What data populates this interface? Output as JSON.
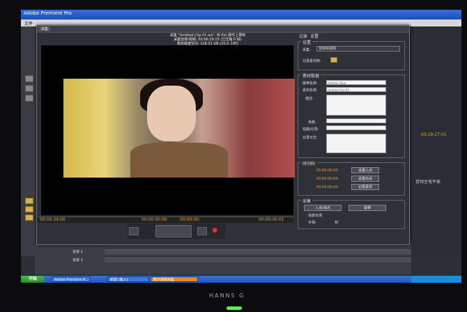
{
  "app": {
    "window_title": "Adobe Premiere Pro",
    "menu": [
      "文件"
    ]
  },
  "capture_dialog": {
    "tab_label": "采集",
    "info_line1": "采集 \"Untitled Clip 01.avi\", 到 Ext 硬件上录制",
    "info_line2": "采集音频/视频: 00:06:29:15 (已压缩 0 帧)",
    "info_line3": "剩余磁盘空间: 128.51 GB (10.0 小时)",
    "timecode_left": "00:06:34:00",
    "timecode_mid1": "00:00:00:00",
    "timecode_mid2": "00:00:00:",
    "timecode_right": "00:00:00:01"
  },
  "side_panel": {
    "tab_record": "记录",
    "tab_settings": "设置",
    "setup_group": "设置",
    "capture_label": "采集:",
    "capture_value": "音频和视频",
    "bin_label": "记录素材到:",
    "clip_data_group": "素材数据",
    "tape_name_label": "磁带名称:",
    "tape_name_value": "Untitled Tape",
    "clip_name_label": "素材名称:",
    "clip_name_value": "Untitled Clip 01",
    "description_label": "描述:",
    "scene_label": "场景:",
    "shot_label": "拍摄/记录:",
    "log_note_label": "记录日志:",
    "timecode_group": "时间码",
    "tc_in": "00:00:00:00",
    "tc_out": "00:00:00:00",
    "tc_dur": "00:00:00:00",
    "btn_set_in": "设置入点",
    "btn_set_out": "设置出点",
    "btn_log_clip": "记录素材",
    "capture_group": "采集",
    "btn_in_out": "入点/出点",
    "btn_tape": "磁带",
    "scene_detect_label": "场景侦测",
    "handles_label": "手柄:",
    "handles_value": "帧"
  },
  "timeline": {
    "track_audio2": "音频 2",
    "track_audio3": "音频 3",
    "timecode": "00:29:27:01",
    "audio_master": "音频主电平表"
  },
  "taskbar": {
    "start_label": "开始",
    "tasks": [
      "Adobe Premiere P...",
      "新建 (载入)",
      "数字视频采集"
    ],
    "tray_time": ""
  },
  "monitor": {
    "brand": "HANNS G"
  }
}
